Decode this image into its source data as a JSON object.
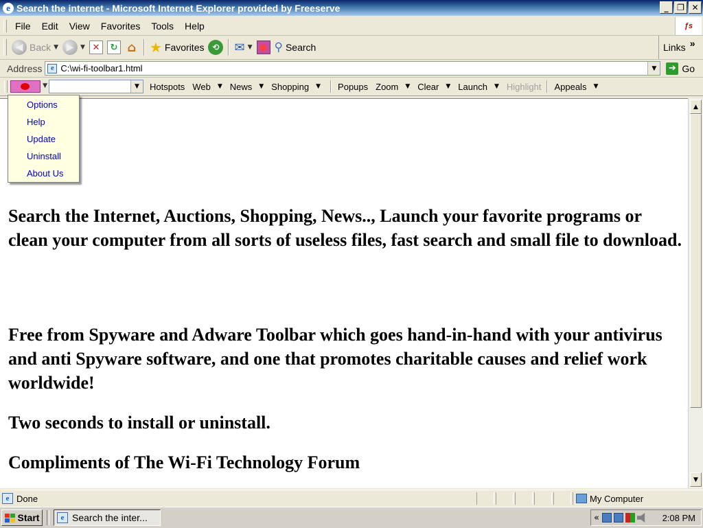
{
  "window": {
    "title": "Search the internet - Microsoft Internet Explorer provided by Freeserve",
    "title_icon": "e",
    "minimize": "_",
    "restore": "❐",
    "close": "✕"
  },
  "menubar": {
    "items": [
      "File",
      "Edit",
      "View",
      "Favorites",
      "Tools",
      "Help"
    ],
    "brand_text": "ƒs"
  },
  "toolbar": {
    "back_label": "Back",
    "favorites_label": "Favorites",
    "search_label": "Search",
    "links_label": "Links",
    "links_more": "»"
  },
  "address": {
    "label": "Address",
    "value": "C:\\wi-fi-toolbar1.html",
    "go_label": "Go"
  },
  "wifi_toolbar": {
    "search_value": "",
    "items": [
      {
        "label": "Hotspots",
        "arrow": false,
        "disabled": false
      },
      {
        "label": "Web",
        "arrow": true,
        "disabled": false
      },
      {
        "label": "News",
        "arrow": true,
        "disabled": false
      },
      {
        "label": "Shopping",
        "arrow": true,
        "disabled": false
      },
      {
        "label": "Popups",
        "arrow": false,
        "disabled": false
      },
      {
        "label": "Zoom",
        "arrow": true,
        "disabled": false
      },
      {
        "label": "Clear",
        "arrow": true,
        "disabled": false
      },
      {
        "label": "Launch",
        "arrow": true,
        "disabled": false
      },
      {
        "label": "Highlight",
        "arrow": false,
        "disabled": true
      },
      {
        "label": "Appeals",
        "arrow": true,
        "disabled": false
      }
    ]
  },
  "dropdown": {
    "items": [
      "Options",
      "Help",
      "Update",
      "Uninstall",
      "About Us"
    ]
  },
  "content": {
    "p1": "Search the Internet, Auctions, Shopping, News.., Launch your favorite programs or clean your computer from all sorts of useless files, fast search and small file to download.",
    "p2": "Free from Spyware and Adware Toolbar which goes hand-in-hand with your antivirus and anti Spyware software, and one that promotes charitable causes and relief work worldwide!",
    "p3": "Two seconds to install or uninstall.",
    "p4": "Compliments of The Wi-Fi Technology Forum"
  },
  "status": {
    "text": "Done",
    "zone": "My Computer"
  },
  "taskbar": {
    "start_label": "Start",
    "task_label": "Search the inter...",
    "clock": "2:08 PM",
    "tray_arrow": "«"
  },
  "colors": {
    "title_bar": "#0a246a",
    "chrome": "#ece9d8",
    "link_blue": "#0000cc",
    "dropdown_bg": "#ffffe1",
    "wifi_logo_pink": "#e070c0",
    "wifi_logo_dot": "#e00000"
  }
}
